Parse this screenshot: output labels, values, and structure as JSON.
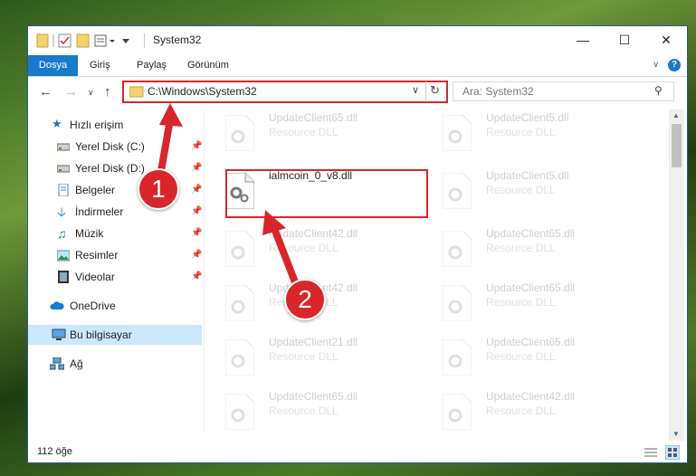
{
  "window": {
    "title": "System32"
  },
  "ribbon": {
    "tabs": [
      "Dosya",
      "Giriş",
      "Paylaş",
      "Görünüm"
    ]
  },
  "address": {
    "path": "C:\\Windows\\System32"
  },
  "search": {
    "placeholder": "Ara: System32"
  },
  "sidebar": {
    "items": [
      {
        "label": "Hızlı erişim",
        "icon": "star-icon"
      },
      {
        "label": "Yerel Disk (C:)",
        "icon": "drive-icon",
        "pinned": true
      },
      {
        "label": "Yerel Disk (D:)",
        "icon": "drive-icon",
        "pinned": true
      },
      {
        "label": "Belgeler",
        "icon": "documents-icon",
        "pinned": true
      },
      {
        "label": "İndirmeler",
        "icon": "downloads-icon",
        "pinned": true
      },
      {
        "label": "Müzik",
        "icon": "music-icon",
        "pinned": true
      },
      {
        "label": "Resimler",
        "icon": "pictures-icon",
        "pinned": true
      },
      {
        "label": "Videolar",
        "icon": "videos-icon",
        "pinned": true
      },
      {
        "label": "OneDrive",
        "icon": "cloud-icon"
      },
      {
        "label": "Bu bilgisayar",
        "icon": "computer-icon",
        "selected": true
      },
      {
        "label": "Ağ",
        "icon": "network-icon"
      }
    ]
  },
  "files": {
    "highlighted": {
      "name": "ialmcoin_0_v8.dll"
    },
    "type_label": "Resource DLL",
    "left_column": [
      "UpdateClient65.dll",
      "UpdateClient42.dll",
      "UpdateClient42.dll",
      "UpdateClient21.dll",
      "UpdateClient65.dll"
    ],
    "right_column": [
      "UpdateClient5.dll",
      "UpdateClient5.dll",
      "UpdateClient65.dll",
      "UpdateClient65.dll",
      "UpdateClient65.dll",
      "UpdateClient42.dll"
    ]
  },
  "status": {
    "count": "112 öğe"
  },
  "annotations": {
    "step1": "1",
    "step2": "2"
  },
  "colors": {
    "accent": "#1979ca",
    "highlight": "#d9262b",
    "selected": "#cce8ff"
  }
}
